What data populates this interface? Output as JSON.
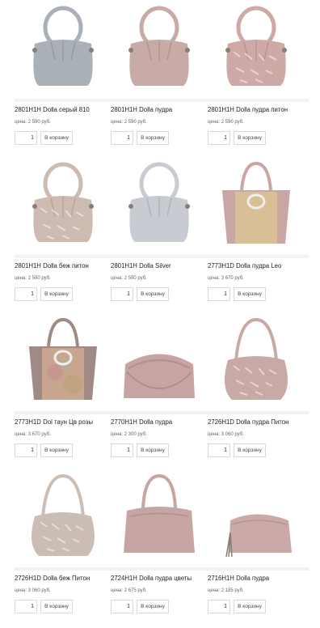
{
  "products": [
    {
      "name": "2801H1H Dolla серый 810",
      "price": "цена: 2 590 руб.",
      "qty": "1",
      "cart": "В корзину",
      "color": "#aab0b7",
      "style": "pleat"
    },
    {
      "name": "2801H1H Dolla пудра",
      "price": "цена: 2 590 руб.",
      "qty": "1",
      "cart": "В корзину",
      "color": "#c8aaa6",
      "style": "pleat"
    },
    {
      "name": "2801H1H Dolla пудра питон",
      "price": "цена: 2 590 руб.",
      "qty": "1",
      "cart": "В корзину",
      "color": "#cfa9a6",
      "style": "pleat-python"
    },
    {
      "name": "2801H1H Dolla беж питон",
      "price": "цена: 2 590 руб.",
      "qty": "1",
      "cart": "В корзину",
      "color": "#cdbbb2",
      "style": "pleat-python"
    },
    {
      "name": "2801H1H Dolla Silver",
      "price": "цена: 2 590 руб.",
      "qty": "1",
      "cart": "В корзину",
      "color": "#c8ccd2",
      "style": "pleat"
    },
    {
      "name": "2773H1D Dolla пудра Leo",
      "price": "цена: 3 670 руб.",
      "qty": "1",
      "cart": "В корзину",
      "color": "#c9a5a3",
      "style": "tote-gold"
    },
    {
      "name": "2773H1D Dol таун Цв розы",
      "price": "цена: 3 670 руб.",
      "qty": "1",
      "cart": "В корзину",
      "color": "#a08a86",
      "style": "tote-floral"
    },
    {
      "name": "2770H1H Dolla пудра",
      "price": "цена: 2 300 руб.",
      "qty": "1",
      "cart": "В корзину",
      "color": "#c7a4a2",
      "style": "clutch"
    },
    {
      "name": "2726H1D Dolla пудра Питон",
      "price": "цена: 3 060 руб.",
      "qty": "1",
      "cart": "В корзину",
      "color": "#c8a9a5",
      "style": "hobo-python"
    },
    {
      "name": "2726H1D Dolla беж Питон",
      "price": "цена: 3 060 руб.",
      "qty": "1",
      "cart": "В корзину",
      "color": "#cbbcb4",
      "style": "hobo-python"
    },
    {
      "name": "2724H1H Dolla пудра цветы",
      "price": "цена: 2 675 руб.",
      "qty": "1",
      "cart": "В корзину",
      "color": "#c6a5a3",
      "style": "bowling"
    },
    {
      "name": "2716H1H Dolla пудра",
      "price": "цена: 2 185 руб.",
      "qty": "1",
      "cart": "В корзину",
      "color": "#cba9a7",
      "style": "crossbody"
    }
  ]
}
